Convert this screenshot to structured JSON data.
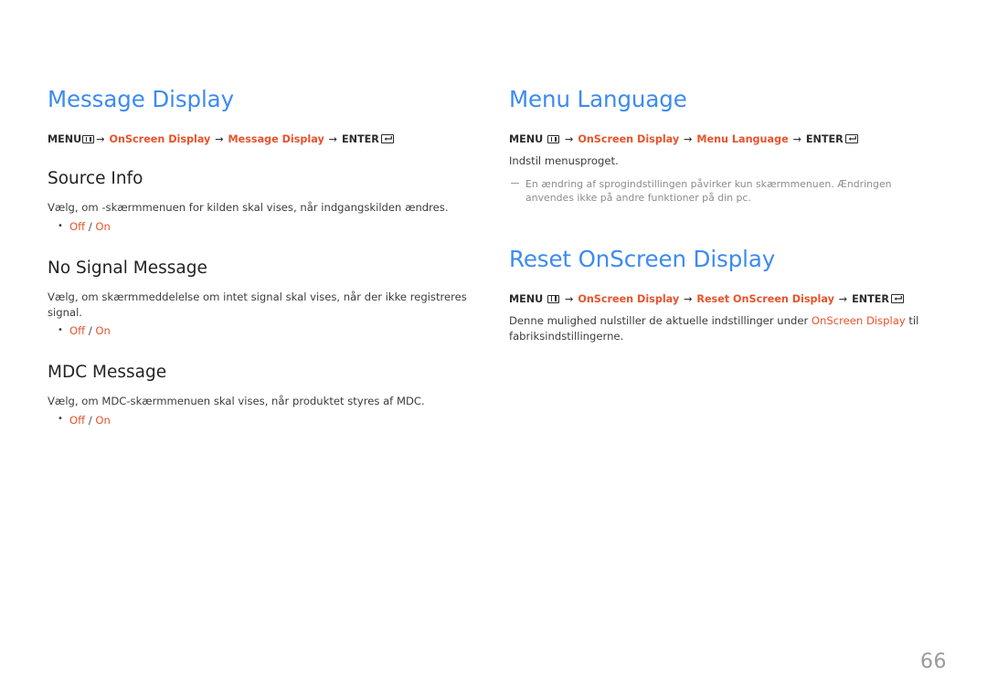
{
  "document": {
    "page_number": "66",
    "colors": {
      "heading_blue": "#3c8bf0",
      "accent_orange": "#e8532b",
      "body_text": "#3c3c3c",
      "note_gray": "#8c8c8c",
      "page_number_gray": "#9a9a9a"
    }
  },
  "left_column": {
    "section": {
      "title": "Message Display",
      "breadcrumb": {
        "menu_label": "MENU",
        "menu_icon": "menu-grid-icon",
        "arrow": "→",
        "path": [
          "OnScreen Display",
          "Message Display"
        ],
        "enter_label": "ENTER",
        "enter_icon": "enter-return-icon"
      }
    },
    "subsections": [
      {
        "title": "Source Info",
        "description": "Vælg, om -skærmmenuen for kilden skal vises, når indgangskilden ændres.",
        "options": {
          "off": "Off",
          "separator": "/",
          "on": "On"
        }
      },
      {
        "title": "No Signal Message",
        "description": "Vælg, om skærmmeddelelse om intet signal skal vises, når der ikke registreres signal.",
        "options": {
          "off": "Off",
          "separator": "/",
          "on": "On"
        }
      },
      {
        "title": "MDC Message",
        "description": "Vælg, om MDC-skærmmenuen skal vises, når produktet styres af MDC.",
        "options": {
          "off": "Off",
          "separator": "/",
          "on": "On"
        }
      }
    ]
  },
  "right_column": {
    "sections": [
      {
        "title": "Menu Language",
        "breadcrumb": {
          "menu_label": "MENU",
          "menu_icon": "menu-grid-icon",
          "arrow": "→",
          "path": [
            "OnScreen Display",
            "Menu Language"
          ],
          "enter_label": "ENTER",
          "enter_icon": "enter-return-icon"
        },
        "description": "Indstil menusproget.",
        "note": "En ændring af sprogindstillingen påvirker kun skærmmenuen. Ændringen anvendes ikke på andre funktioner på din pc."
      },
      {
        "title": "Reset OnScreen Display",
        "breadcrumb": {
          "menu_label": "MENU",
          "menu_icon": "menu-grid-icon",
          "arrow": "→",
          "path": [
            "OnScreen Display",
            "Reset OnScreen Display"
          ],
          "enter_label": "ENTER",
          "enter_icon": "enter-return-icon"
        },
        "description_before": "Denne mulighed nulstiller de aktuelle indstillinger under ",
        "description_accent": "OnScreen Display",
        "description_after": " til fabriksindstillingerne."
      }
    ]
  }
}
